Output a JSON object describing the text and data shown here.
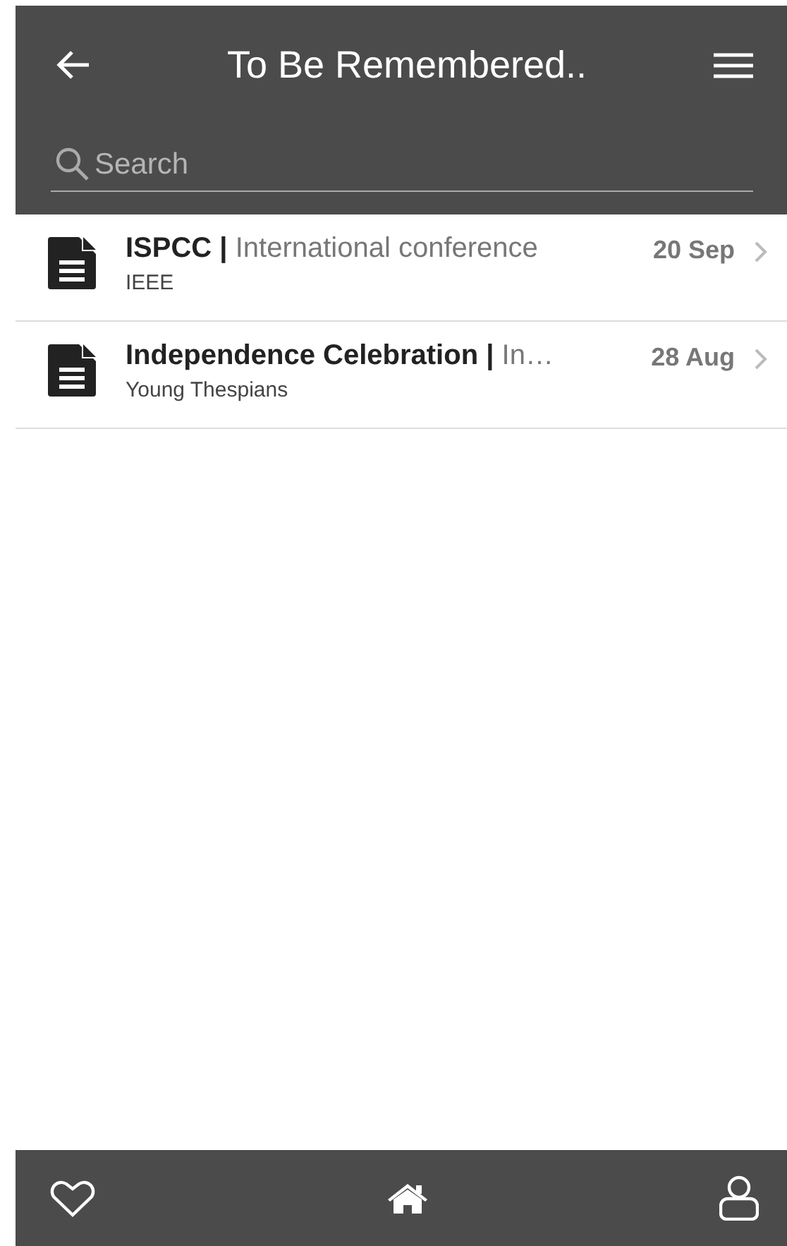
{
  "header": {
    "title": "To Be Remembered.."
  },
  "search": {
    "placeholder": "Search"
  },
  "items": [
    {
      "title": "**ISPCC |** International conference",
      "subtitle": "IEEE",
      "date": "20 Sep"
    },
    {
      "title": "**Independence Celebration |** In…",
      "subtitle": "Young Thespians",
      "date": "28 Aug"
    }
  ]
}
